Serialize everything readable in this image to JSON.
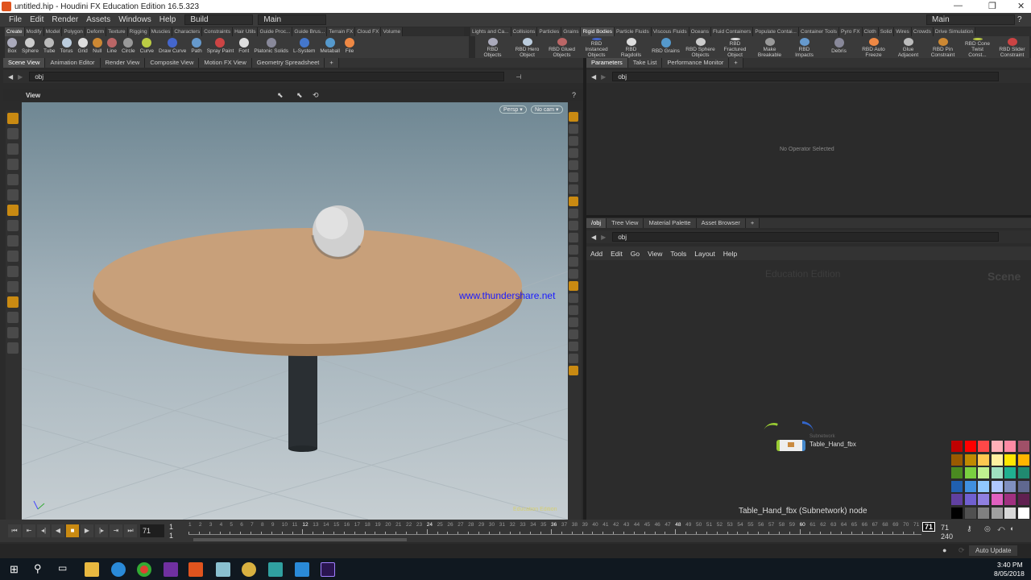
{
  "window": {
    "title": "untitled.hip - Houdini FX Education Edition 16.5.323",
    "controls": [
      "—",
      "❐",
      "✕"
    ]
  },
  "menu": [
    "File",
    "Edit",
    "Render",
    "Assets",
    "Windows",
    "Help"
  ],
  "desktop_left": "Build",
  "desktop_right": "Main",
  "desktop_main2": "Main",
  "shelf_left": {
    "tabs": [
      "Create",
      "Modify",
      "Model",
      "Polygon",
      "Deform",
      "Texture",
      "Rigging",
      "Muscles",
      "Characters",
      "Constraints",
      "Hair Utils",
      "Guide Proc...",
      "Guide Brus...",
      "Terrain FX",
      "Cloud FX",
      "Volume"
    ],
    "tools": [
      "Box",
      "Sphere",
      "Tube",
      "Torus",
      "Grid",
      "Null",
      "Line",
      "Circle",
      "Curve",
      "Draw Curve",
      "Path",
      "Spray Paint",
      "Font",
      "Platonic Solids",
      "L-System",
      "Metaball",
      "File"
    ]
  },
  "shelf_right": {
    "tabs": [
      "Lights and Ca...",
      "Collisions",
      "Particles",
      "Grains",
      "Rigid Bodies",
      "Particle Fluids",
      "Viscous Fluids",
      "Oceans",
      "Fluid Containers",
      "Populate Contai...",
      "Container Tools",
      "Pyro FX",
      "Cloth",
      "Solid",
      "Wires",
      "Crowds",
      "Drive Simulation"
    ],
    "tools": [
      "RBD Objects",
      "RBD Hero Object",
      "RBD Glued Objects",
      "RBD Instanced Objects",
      "RBD Ragdolls",
      "RBD Grains",
      "RBD Sphere Objects",
      "RBD Fractured Object",
      "Make Breakable",
      "RBD Impacts",
      "Debris",
      "RBD Auto Freeze",
      "Glue Adjacent",
      "RBD Pin Constraint",
      "RBD Cone Twist Const...",
      "RBD Slider Constraint"
    ]
  },
  "left_pane": {
    "tabs": [
      "Scene View",
      "Animation Editor",
      "Render View",
      "Composite View",
      "Motion FX View",
      "Geometry Spreadsheet"
    ],
    "path": "obj",
    "view_label": "View",
    "persp": "Persp ▾",
    "cam": "No cam ▾",
    "watermark": "www.thundershare.net",
    "edu_label": "Education Edition"
  },
  "param_pane": {
    "tabs": [
      "Parameters",
      "Take List",
      "Performance Monitor"
    ],
    "path": "obj",
    "empty": "No Operator Selected"
  },
  "network_pane": {
    "tabs": [
      "/obj",
      "Tree View",
      "Material Palette",
      "Asset Browser"
    ],
    "path": "obj",
    "menu": [
      "Add",
      "Edit",
      "Go",
      "View",
      "Tools",
      "Layout",
      "Help"
    ],
    "edu": "Education Edition",
    "context": "Scene",
    "node": {
      "type": "Subnetwork",
      "name": "Table_Hand_fbx"
    },
    "status": "Table_Hand_fbx (Subnetwork) node"
  },
  "palette": [
    "#c00000",
    "#ff0000",
    "#ff4848",
    "#ffb0b8",
    "#ff8aa4",
    "#a05068",
    "#9a5a00",
    "#c08a00",
    "#ffc850",
    "#fff0a0",
    "#ffe600",
    "#ffb400",
    "#4a8a20",
    "#7ad040",
    "#c0f090",
    "#a0e0c0",
    "#20b090",
    "#208a70",
    "#2060b0",
    "#4090e0",
    "#90c8ff",
    "#b0c8ff",
    "#8090c0",
    "#606890",
    "#6040a0",
    "#7060d0",
    "#9080e0",
    "#e060c0",
    "#a03080",
    "#602050",
    "#000000",
    "#505050",
    "#808080",
    "#a0a0a0",
    "#d8d8d8",
    "#ffffff"
  ],
  "timeline": {
    "current": "71",
    "start": "1",
    "start2": "1",
    "end_current": "71",
    "end": "240",
    "first_frame": 1,
    "last_frame": 71,
    "bold_every": 12
  },
  "status_right": {
    "auto_update": "Auto Update"
  },
  "clock": {
    "time": "3:40 PM",
    "date": "8/05/2018"
  }
}
